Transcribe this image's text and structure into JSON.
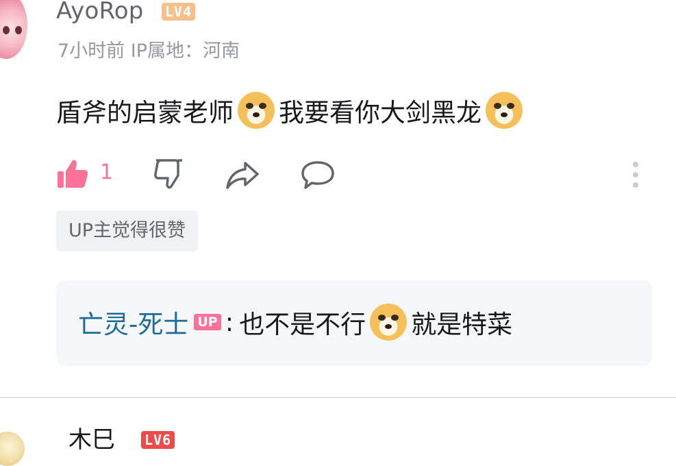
{
  "comment": {
    "username": "AyoRop",
    "level_badge": "LV4",
    "meta": "7小时前  IP属地：河南",
    "content_part1": "盾斧的启蒙老师",
    "content_part2": "我要看你大剑黑龙",
    "emoji_name": "doge-emoji",
    "like_count": "1",
    "up_liked_label": "UP主觉得很赞"
  },
  "reply": {
    "username": "亡灵-死士",
    "up_tag": "UP",
    "separator": ":",
    "text_part1": "也不是不行",
    "text_part2": "就是特菜"
  },
  "next_comment": {
    "username": "木巳",
    "level_badge": "LV6"
  },
  "colors": {
    "accent_pink": "#fb7299",
    "reply_user_blue": "#1a6a9a",
    "lv4": "#f7c08b",
    "lv6": "#ee4a4a"
  }
}
